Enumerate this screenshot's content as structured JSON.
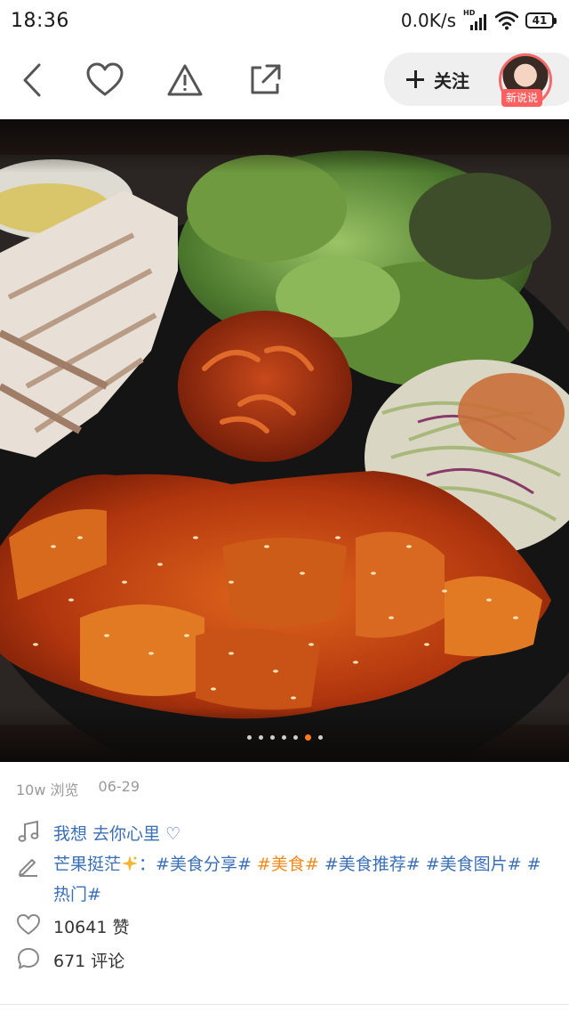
{
  "status_bar": {
    "time": "18:36",
    "net_speed": "0.0K/s",
    "signal_label": "HD",
    "battery": "41"
  },
  "toolbar": {
    "icons": [
      "back-icon",
      "heart-icon",
      "warning-icon",
      "share-icon"
    ],
    "follow_label": "关注",
    "avatar_badge": "新说说"
  },
  "carousel": {
    "total": 7,
    "active_index": 5
  },
  "meta": {
    "views": "10w 浏览",
    "date": "06-29"
  },
  "post": {
    "music": "我想  去你心里 ♡",
    "author": "芒果挺茫",
    "separator": "：",
    "tags": [
      {
        "text": "#美食分享#",
        "color": "#3a6fb6"
      },
      {
        "text": "#美食#",
        "color": "#f08a1c"
      },
      {
        "text": "#美食推荐#",
        "color": "#3a6fb6"
      },
      {
        "text": "#美食图片#",
        "color": "#3a6fb6"
      },
      {
        "text": "#热门#",
        "color": "#3a6fb6"
      }
    ],
    "likes": "10641 赞",
    "comments": "671 评论"
  },
  "colors": {
    "accent": "#ff7a1a",
    "link": "#3a6fb6",
    "badge": "#ff5f5f"
  }
}
